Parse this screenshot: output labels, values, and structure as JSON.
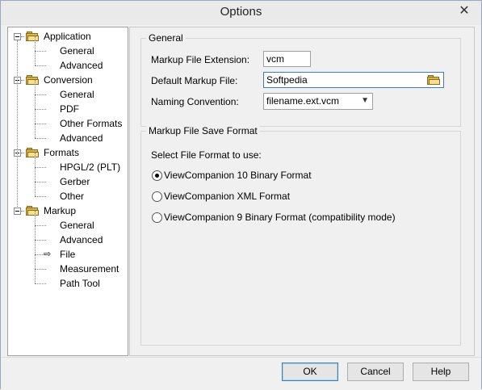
{
  "window": {
    "title": "Options",
    "close_glyph": "✕"
  },
  "tree": {
    "nodes": [
      {
        "label": "Application",
        "level": 0
      },
      {
        "label": "General",
        "level": 1
      },
      {
        "label": "Advanced",
        "level": 1
      },
      {
        "label": "Conversion",
        "level": 0
      },
      {
        "label": "General",
        "level": 1
      },
      {
        "label": "PDF",
        "level": 1
      },
      {
        "label": "Other Formats",
        "level": 1
      },
      {
        "label": "Advanced",
        "level": 1
      },
      {
        "label": "Formats",
        "level": 0
      },
      {
        "label": "HPGL/2 (PLT)",
        "level": 1
      },
      {
        "label": "Gerber",
        "level": 1
      },
      {
        "label": "Other",
        "level": 1
      },
      {
        "label": "Markup",
        "level": 0
      },
      {
        "label": "General",
        "level": 1
      },
      {
        "label": "Advanced",
        "level": 1
      },
      {
        "label": "File",
        "level": 1,
        "selected": true
      },
      {
        "label": "Measurement",
        "level": 1
      },
      {
        "label": "Path Tool",
        "level": 1
      }
    ]
  },
  "general_group": {
    "title": "General",
    "ext_label": "Markup File Extension:",
    "ext_value": "vcm",
    "default_label": "Default Markup File:",
    "default_value": "Softpedia",
    "naming_label": "Naming Convention:",
    "naming_value": "filename.ext.vcm"
  },
  "save_group": {
    "title": "Markup File Save Format",
    "prompt": "Select File Format to use:",
    "options": [
      {
        "label": "ViewCompanion 10 Binary Format",
        "checked": true
      },
      {
        "label": "ViewCompanion XML Format",
        "checked": false
      },
      {
        "label": "ViewCompanion 9 Binary Format (compatibility mode)",
        "checked": false
      }
    ]
  },
  "buttons": {
    "ok": "OK",
    "cancel": "Cancel",
    "help": "Help"
  },
  "colors": {
    "folder": "#d9b54a",
    "default_button_border": "#3c7fb1"
  }
}
